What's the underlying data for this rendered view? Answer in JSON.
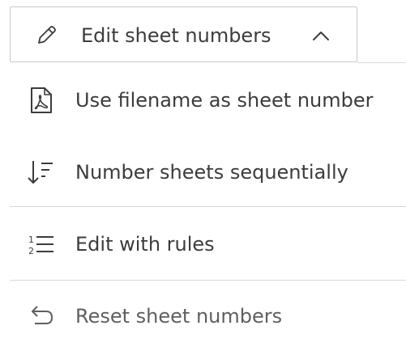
{
  "trigger": {
    "label": "Edit sheet numbers",
    "icon": "pencil-icon",
    "chevron": "chevron-up-icon"
  },
  "menu": {
    "items": [
      {
        "label": "Use filename as sheet number",
        "icon": "pdf-file-icon"
      },
      {
        "label": "Number sheets sequentially",
        "icon": "sort-descending-icon"
      },
      {
        "label": "Edit with rules",
        "icon": "numbered-list-icon"
      },
      {
        "label": "Reset sheet numbers",
        "icon": "undo-arrow-icon"
      }
    ]
  },
  "colors": {
    "text": "#3c3c3c",
    "border": "#c9c9c9",
    "divider": "#d9d9d9"
  }
}
